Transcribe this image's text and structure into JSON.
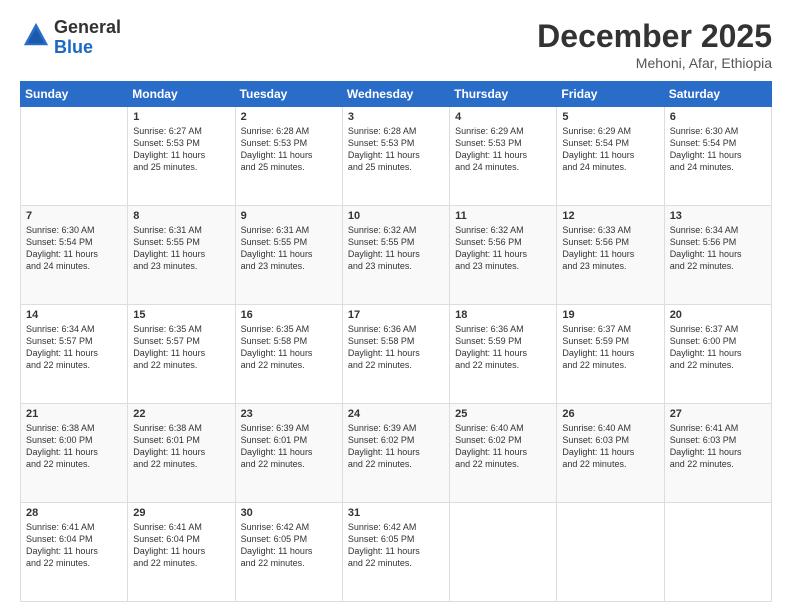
{
  "logo": {
    "line1": "General",
    "line2": "Blue"
  },
  "title": "December 2025",
  "subtitle": "Mehoni, Afar, Ethiopia",
  "days_header": [
    "Sunday",
    "Monday",
    "Tuesday",
    "Wednesday",
    "Thursday",
    "Friday",
    "Saturday"
  ],
  "weeks": [
    [
      {
        "day": "",
        "info": ""
      },
      {
        "day": "1",
        "info": "Sunrise: 6:27 AM\nSunset: 5:53 PM\nDaylight: 11 hours\nand 25 minutes."
      },
      {
        "day": "2",
        "info": "Sunrise: 6:28 AM\nSunset: 5:53 PM\nDaylight: 11 hours\nand 25 minutes."
      },
      {
        "day": "3",
        "info": "Sunrise: 6:28 AM\nSunset: 5:53 PM\nDaylight: 11 hours\nand 25 minutes."
      },
      {
        "day": "4",
        "info": "Sunrise: 6:29 AM\nSunset: 5:53 PM\nDaylight: 11 hours\nand 24 minutes."
      },
      {
        "day": "5",
        "info": "Sunrise: 6:29 AM\nSunset: 5:54 PM\nDaylight: 11 hours\nand 24 minutes."
      },
      {
        "day": "6",
        "info": "Sunrise: 6:30 AM\nSunset: 5:54 PM\nDaylight: 11 hours\nand 24 minutes."
      }
    ],
    [
      {
        "day": "7",
        "info": "Sunrise: 6:30 AM\nSunset: 5:54 PM\nDaylight: 11 hours\nand 24 minutes."
      },
      {
        "day": "8",
        "info": "Sunrise: 6:31 AM\nSunset: 5:55 PM\nDaylight: 11 hours\nand 23 minutes."
      },
      {
        "day": "9",
        "info": "Sunrise: 6:31 AM\nSunset: 5:55 PM\nDaylight: 11 hours\nand 23 minutes."
      },
      {
        "day": "10",
        "info": "Sunrise: 6:32 AM\nSunset: 5:55 PM\nDaylight: 11 hours\nand 23 minutes."
      },
      {
        "day": "11",
        "info": "Sunrise: 6:32 AM\nSunset: 5:56 PM\nDaylight: 11 hours\nand 23 minutes."
      },
      {
        "day": "12",
        "info": "Sunrise: 6:33 AM\nSunset: 5:56 PM\nDaylight: 11 hours\nand 23 minutes."
      },
      {
        "day": "13",
        "info": "Sunrise: 6:34 AM\nSunset: 5:56 PM\nDaylight: 11 hours\nand 22 minutes."
      }
    ],
    [
      {
        "day": "14",
        "info": "Sunrise: 6:34 AM\nSunset: 5:57 PM\nDaylight: 11 hours\nand 22 minutes."
      },
      {
        "day": "15",
        "info": "Sunrise: 6:35 AM\nSunset: 5:57 PM\nDaylight: 11 hours\nand 22 minutes."
      },
      {
        "day": "16",
        "info": "Sunrise: 6:35 AM\nSunset: 5:58 PM\nDaylight: 11 hours\nand 22 minutes."
      },
      {
        "day": "17",
        "info": "Sunrise: 6:36 AM\nSunset: 5:58 PM\nDaylight: 11 hours\nand 22 minutes."
      },
      {
        "day": "18",
        "info": "Sunrise: 6:36 AM\nSunset: 5:59 PM\nDaylight: 11 hours\nand 22 minutes."
      },
      {
        "day": "19",
        "info": "Sunrise: 6:37 AM\nSunset: 5:59 PM\nDaylight: 11 hours\nand 22 minutes."
      },
      {
        "day": "20",
        "info": "Sunrise: 6:37 AM\nSunset: 6:00 PM\nDaylight: 11 hours\nand 22 minutes."
      }
    ],
    [
      {
        "day": "21",
        "info": "Sunrise: 6:38 AM\nSunset: 6:00 PM\nDaylight: 11 hours\nand 22 minutes."
      },
      {
        "day": "22",
        "info": "Sunrise: 6:38 AM\nSunset: 6:01 PM\nDaylight: 11 hours\nand 22 minutes."
      },
      {
        "day": "23",
        "info": "Sunrise: 6:39 AM\nSunset: 6:01 PM\nDaylight: 11 hours\nand 22 minutes."
      },
      {
        "day": "24",
        "info": "Sunrise: 6:39 AM\nSunset: 6:02 PM\nDaylight: 11 hours\nand 22 minutes."
      },
      {
        "day": "25",
        "info": "Sunrise: 6:40 AM\nSunset: 6:02 PM\nDaylight: 11 hours\nand 22 minutes."
      },
      {
        "day": "26",
        "info": "Sunrise: 6:40 AM\nSunset: 6:03 PM\nDaylight: 11 hours\nand 22 minutes."
      },
      {
        "day": "27",
        "info": "Sunrise: 6:41 AM\nSunset: 6:03 PM\nDaylight: 11 hours\nand 22 minutes."
      }
    ],
    [
      {
        "day": "28",
        "info": "Sunrise: 6:41 AM\nSunset: 6:04 PM\nDaylight: 11 hours\nand 22 minutes."
      },
      {
        "day": "29",
        "info": "Sunrise: 6:41 AM\nSunset: 6:04 PM\nDaylight: 11 hours\nand 22 minutes."
      },
      {
        "day": "30",
        "info": "Sunrise: 6:42 AM\nSunset: 6:05 PM\nDaylight: 11 hours\nand 22 minutes."
      },
      {
        "day": "31",
        "info": "Sunrise: 6:42 AM\nSunset: 6:05 PM\nDaylight: 11 hours\nand 22 minutes."
      },
      {
        "day": "",
        "info": ""
      },
      {
        "day": "",
        "info": ""
      },
      {
        "day": "",
        "info": ""
      }
    ]
  ]
}
